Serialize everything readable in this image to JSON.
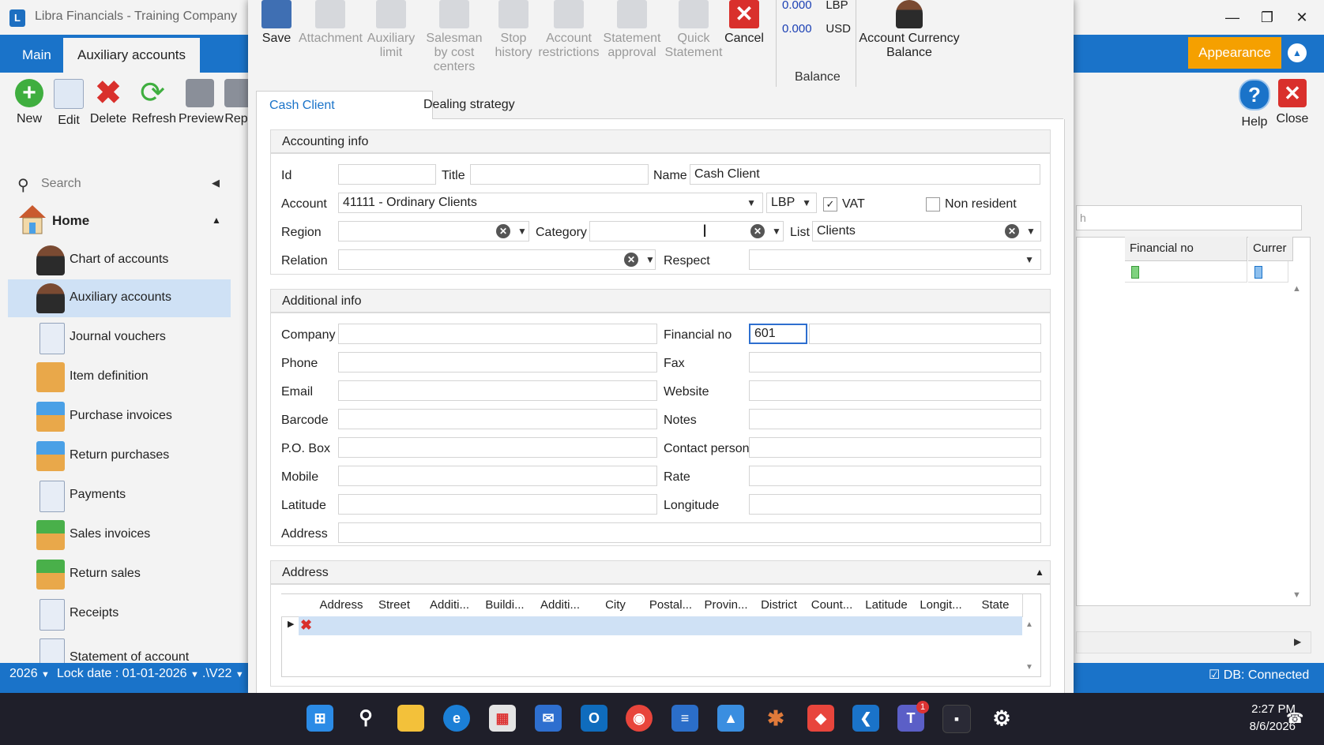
{
  "window": {
    "title": "Libra Financials - Training Company",
    "controls": [
      "minimize",
      "restore",
      "close"
    ]
  },
  "ribbon": {
    "tabs": [
      "Main",
      "Auxiliary accounts"
    ],
    "buttons": [
      "New",
      "Edit",
      "Delete",
      "Refresh",
      "Preview",
      "Rep"
    ],
    "appearance": "Appearance",
    "help": "Help",
    "close": "Close"
  },
  "sidebar": {
    "search_placeholder": "Search",
    "home": "Home",
    "items": [
      {
        "label": "Chart of accounts",
        "icon": "person-icon"
      },
      {
        "label": "Auxiliary accounts",
        "icon": "person-icon",
        "selected": true
      },
      {
        "label": "Journal vouchers",
        "icon": "document-icon"
      },
      {
        "label": "Item definition",
        "icon": "box-icon"
      },
      {
        "label": "Purchase invoices",
        "icon": "tray-up-icon"
      },
      {
        "label": "Return purchases",
        "icon": "tray-up-icon"
      },
      {
        "label": "Payments",
        "icon": "document-icon"
      },
      {
        "label": "Sales invoices",
        "icon": "tray-down-icon"
      },
      {
        "label": "Return sales",
        "icon": "tray-down-icon"
      },
      {
        "label": "Receipts",
        "icon": "document-icon"
      },
      {
        "label": "Statement of account",
        "icon": "document-icon"
      }
    ]
  },
  "status": {
    "year": "2026",
    "lock_date": "Lock date : 01-01-2026",
    "version": ".\\V22",
    "db": "DB: Connected"
  },
  "right_grid": {
    "search_partial": "h",
    "columns": [
      "Financial no",
      "Currer"
    ]
  },
  "dialog": {
    "toolbar": [
      {
        "label": "Save",
        "enabled": true
      },
      {
        "label": "Attachment",
        "enabled": false
      },
      {
        "label": "Auxiliary limit",
        "enabled": false
      },
      {
        "label": "Salesman by cost centers",
        "enabled": false
      },
      {
        "label": "Stop history",
        "enabled": false
      },
      {
        "label": "Account restrictions",
        "enabled": false
      },
      {
        "label": "Statement approval",
        "enabled": false
      },
      {
        "label": "Quick Statement",
        "enabled": false
      },
      {
        "label": "Cancel",
        "enabled": true
      }
    ],
    "balance": {
      "rows": [
        {
          "value": "0.000",
          "currency": "LBP"
        },
        {
          "value": "0.000",
          "currency": "USD"
        }
      ],
      "label": "Balance"
    },
    "account_currency_balance": "Account Currency Balance",
    "tabs": [
      "Cash Client",
      "Dealing strategy"
    ],
    "accounting_info": {
      "header": "Accounting info",
      "labels": {
        "id": "Id",
        "title": "Title",
        "name": "Name",
        "account": "Account",
        "region": "Region",
        "category": "Category",
        "list": "List",
        "relation": "Relation",
        "respect": "Respect",
        "vat": "VAT",
        "non_resident": "Non resident"
      },
      "values": {
        "id": "",
        "title": "",
        "name": "Cash Client",
        "account": "41111 - Ordinary Clients",
        "currency": "LBP",
        "region": "",
        "category": "",
        "list": "Clients",
        "relation": "",
        "respect": "",
        "vat_checked": true,
        "non_resident_checked": false
      }
    },
    "additional_info": {
      "header": "Additional info",
      "left": [
        "Company",
        "Phone",
        "Email",
        "Barcode",
        "P.O. Box",
        "Mobile",
        "Latitude",
        "Address"
      ],
      "right": [
        "Financial no",
        "Fax",
        "Website",
        "Notes",
        "Contact person",
        "Rate",
        "Longitude"
      ],
      "financial_no": "601"
    },
    "address": {
      "header": "Address",
      "columns": [
        "Address",
        "Street",
        "Additi...",
        "Buildi...",
        "Additi...",
        "City",
        "Postal...",
        "Provin...",
        "District",
        "Count...",
        "Latitude",
        "Longit...",
        "State"
      ]
    }
  },
  "taskbar": {
    "time": "2:27 PM",
    "date": "8/6/2026",
    "teams_badge": "1"
  }
}
